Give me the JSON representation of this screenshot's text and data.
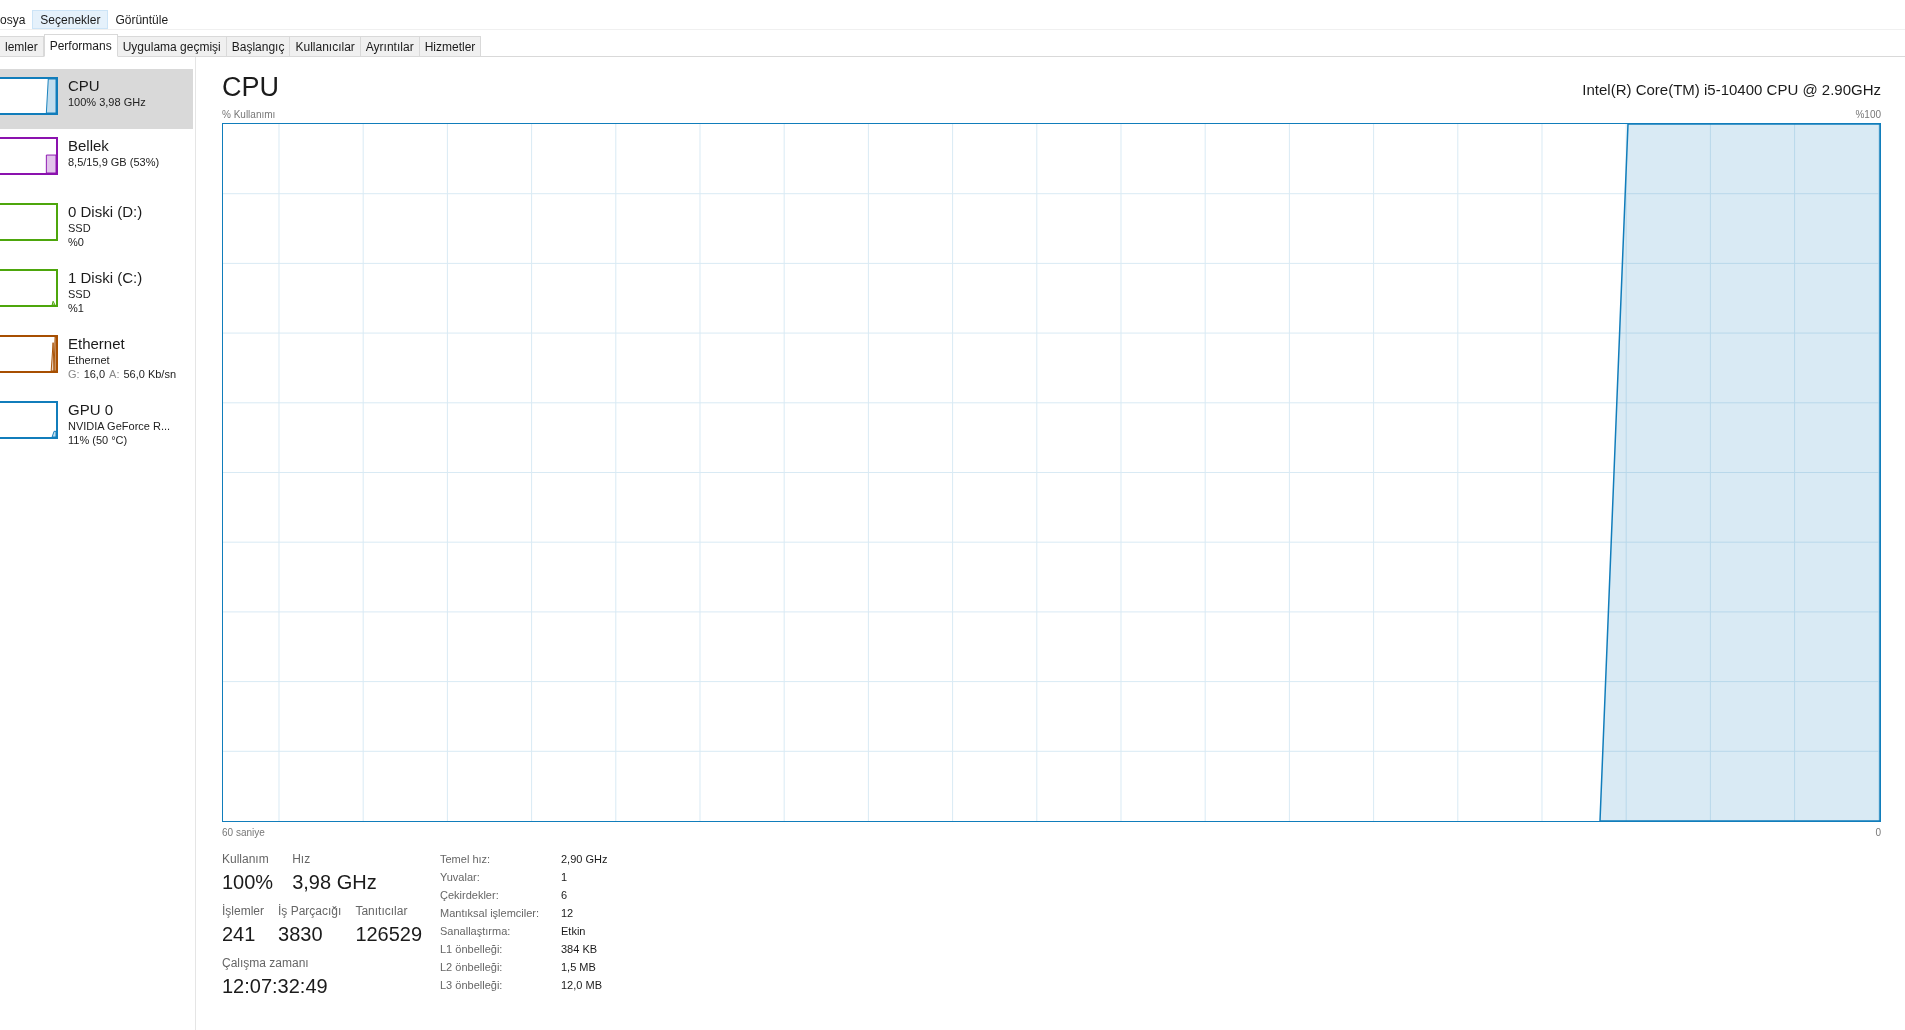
{
  "menu": [
    {
      "label": "osya",
      "selected": false
    },
    {
      "label": "Seçenekler",
      "selected": true
    },
    {
      "label": "Görüntüle",
      "selected": false
    }
  ],
  "tabs": [
    {
      "label": "lemler",
      "selected": false
    },
    {
      "label": "Performans",
      "selected": true
    },
    {
      "label": "Uygulama geçmişi",
      "selected": false
    },
    {
      "label": "Başlangıç",
      "selected": false
    },
    {
      "label": "Kullanıcılar",
      "selected": false
    },
    {
      "label": "Ayrıntılar",
      "selected": false
    },
    {
      "label": "Hizmetler",
      "selected": false
    }
  ],
  "sidebar": {
    "items": [
      {
        "kind": "cpu",
        "color": "#117dbb",
        "selected": true,
        "title": "CPU",
        "lines": [
          "100% 3,98 GHz"
        ]
      },
      {
        "kind": "memory",
        "color": "#8b12ae",
        "selected": false,
        "title": "Bellek",
        "lines": [
          "8,5/15,9 GB (53%)"
        ]
      },
      {
        "kind": "disk_idle",
        "color": "#4da60c",
        "selected": false,
        "title": "0 Diski (D:)",
        "lines": [
          "SSD",
          "%0"
        ]
      },
      {
        "kind": "disk",
        "color": "#4da60c",
        "selected": false,
        "title": "1 Diski (C:)",
        "lines": [
          "SSD",
          "%1"
        ]
      },
      {
        "kind": "network",
        "color": "#a74f01",
        "selected": false,
        "title": "Ethernet",
        "lines": [
          "Ethernet",
          [
            {
              "text": "G:",
              "muted": true
            },
            {
              "text": "16,0",
              "muted": false
            },
            {
              "text": "A:",
              "muted": true
            },
            {
              "text": "56,0 Kb/sn",
              "muted": false
            }
          ]
        ]
      },
      {
        "kind": "gpu",
        "color": "#117dbb",
        "selected": false,
        "title": "GPU 0",
        "lines": [
          "NVIDIA GeForce R...",
          "11% (50 °C)"
        ]
      }
    ]
  },
  "main": {
    "title": "CPU",
    "processor": "Intel(R) Core(TM) i5-10400 CPU @ 2.90GHz",
    "graph": {
      "ylabel": "% Kullanımı",
      "y_max_label": "%100",
      "x_start_label": "60 saniye",
      "x_end_label": "0"
    },
    "stats": [
      {
        "label": "Kullanım",
        "value": "100%"
      },
      {
        "label": "Hız",
        "value": "3,98 GHz"
      }
    ],
    "counts": [
      {
        "label": "İşlemler",
        "value": "241"
      },
      {
        "label": "İş Parçacığı",
        "value": "3830"
      },
      {
        "label": "Tanıtıcılar",
        "value": "126529"
      }
    ],
    "uptime": {
      "label": "Çalışma zamanı",
      "value": "12:07:32:49"
    },
    "details": [
      {
        "label": "Temel hız:",
        "value": "2,90 GHz"
      },
      {
        "label": "Yuvalar:",
        "value": "1"
      },
      {
        "label": "Çekirdekler:",
        "value": "6"
      },
      {
        "label": "Mantıksal işlemciler:",
        "value": "12"
      },
      {
        "label": "Sanallaştırma:",
        "value": "Etkin"
      },
      {
        "label": "L1 önbelleği:",
        "value": "384 KB"
      },
      {
        "label": "L2 önbelleği:",
        "value": "1,5 MB"
      },
      {
        "label": "L3 önbelleği:",
        "value": "12,0 MB"
      }
    ]
  }
}
